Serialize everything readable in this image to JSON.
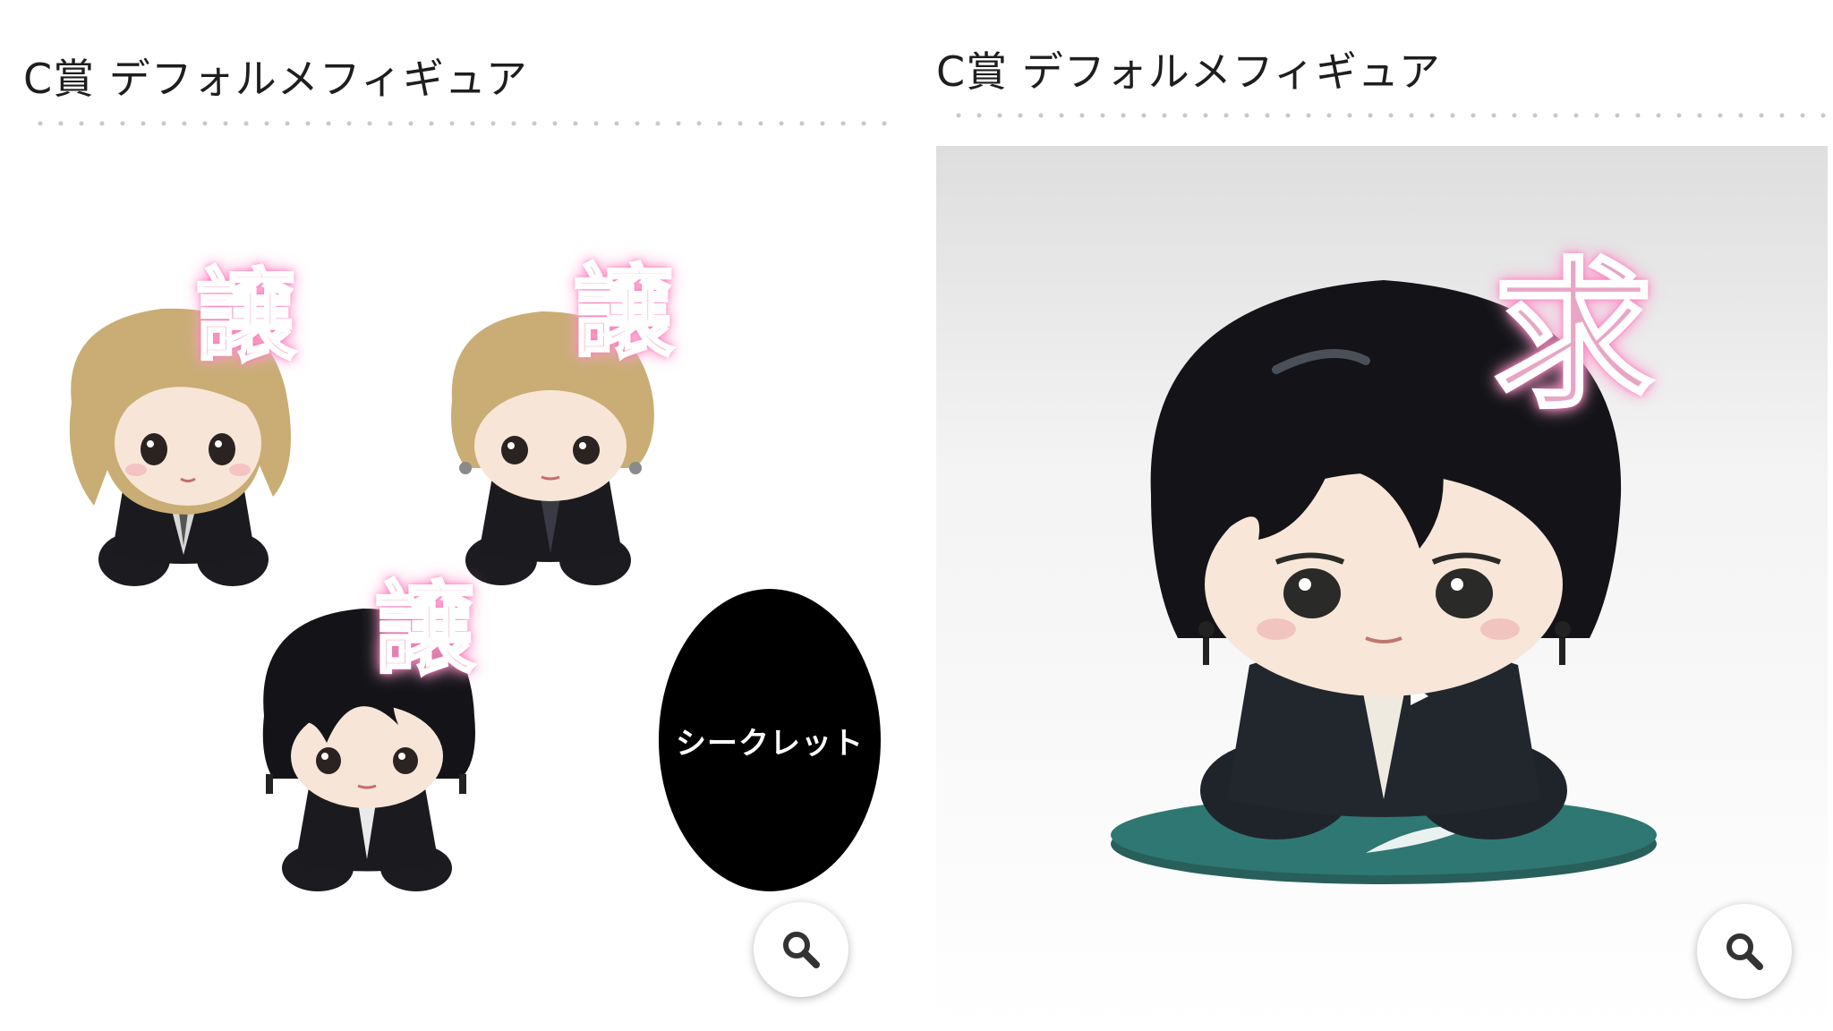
{
  "left": {
    "title": "C賞 デフォルメフィギュア",
    "figures": [
      {
        "name": "blonde-figure-1",
        "stamp": "譲"
      },
      {
        "name": "blonde-figure-2",
        "stamp": "譲"
      },
      {
        "name": "black-hair-figure",
        "stamp": "譲"
      }
    ],
    "secret_label": "シークレット",
    "zoom_icon": "magnifier-icon"
  },
  "right": {
    "title": "C賞 デフォルメフィギュア",
    "figure_stamp": "求",
    "zoom_icon": "magnifier-icon"
  },
  "colors": {
    "stamp_pink": "#e8a6c5",
    "stamp_glow": "#ff5fb0",
    "base_teal": "#2d6e6a",
    "hair_blonde": "#c9ad74",
    "hair_black": "#141418",
    "suit_black": "#1b1b1f"
  }
}
